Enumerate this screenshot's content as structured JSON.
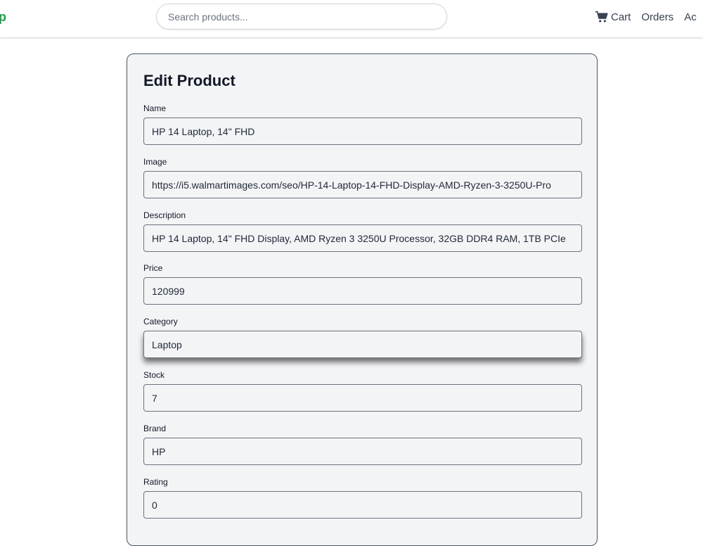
{
  "header": {
    "logo": "p",
    "search_placeholder": "Search products...",
    "nav": [
      {
        "label": "Cart",
        "icon": "cart-icon"
      },
      {
        "label": "Orders"
      },
      {
        "label": "Ac"
      }
    ]
  },
  "form": {
    "title": "Edit Product",
    "fields": [
      {
        "label": "Name",
        "value": "HP 14 Laptop, 14\" FHD"
      },
      {
        "label": "Image",
        "value": "https://i5.walmartimages.com/seo/HP-14-Laptop-14-FHD-Display-AMD-Ryzen-3-3250U-Pro"
      },
      {
        "label": "Description",
        "value": "HP 14 Laptop, 14\" FHD Display, AMD Ryzen 3 3250U Processor, 32GB DDR4 RAM, 1TB PCIe"
      },
      {
        "label": "Price",
        "value": "120999"
      },
      {
        "label": "Category",
        "value": "Laptop"
      },
      {
        "label": "Stock",
        "value": "7"
      },
      {
        "label": "Brand",
        "value": "HP"
      },
      {
        "label": "Rating",
        "value": "0"
      }
    ]
  },
  "colors": {
    "brand": "#16a34a",
    "card_bg": "#f3f4f6",
    "border": "#6b7280"
  }
}
